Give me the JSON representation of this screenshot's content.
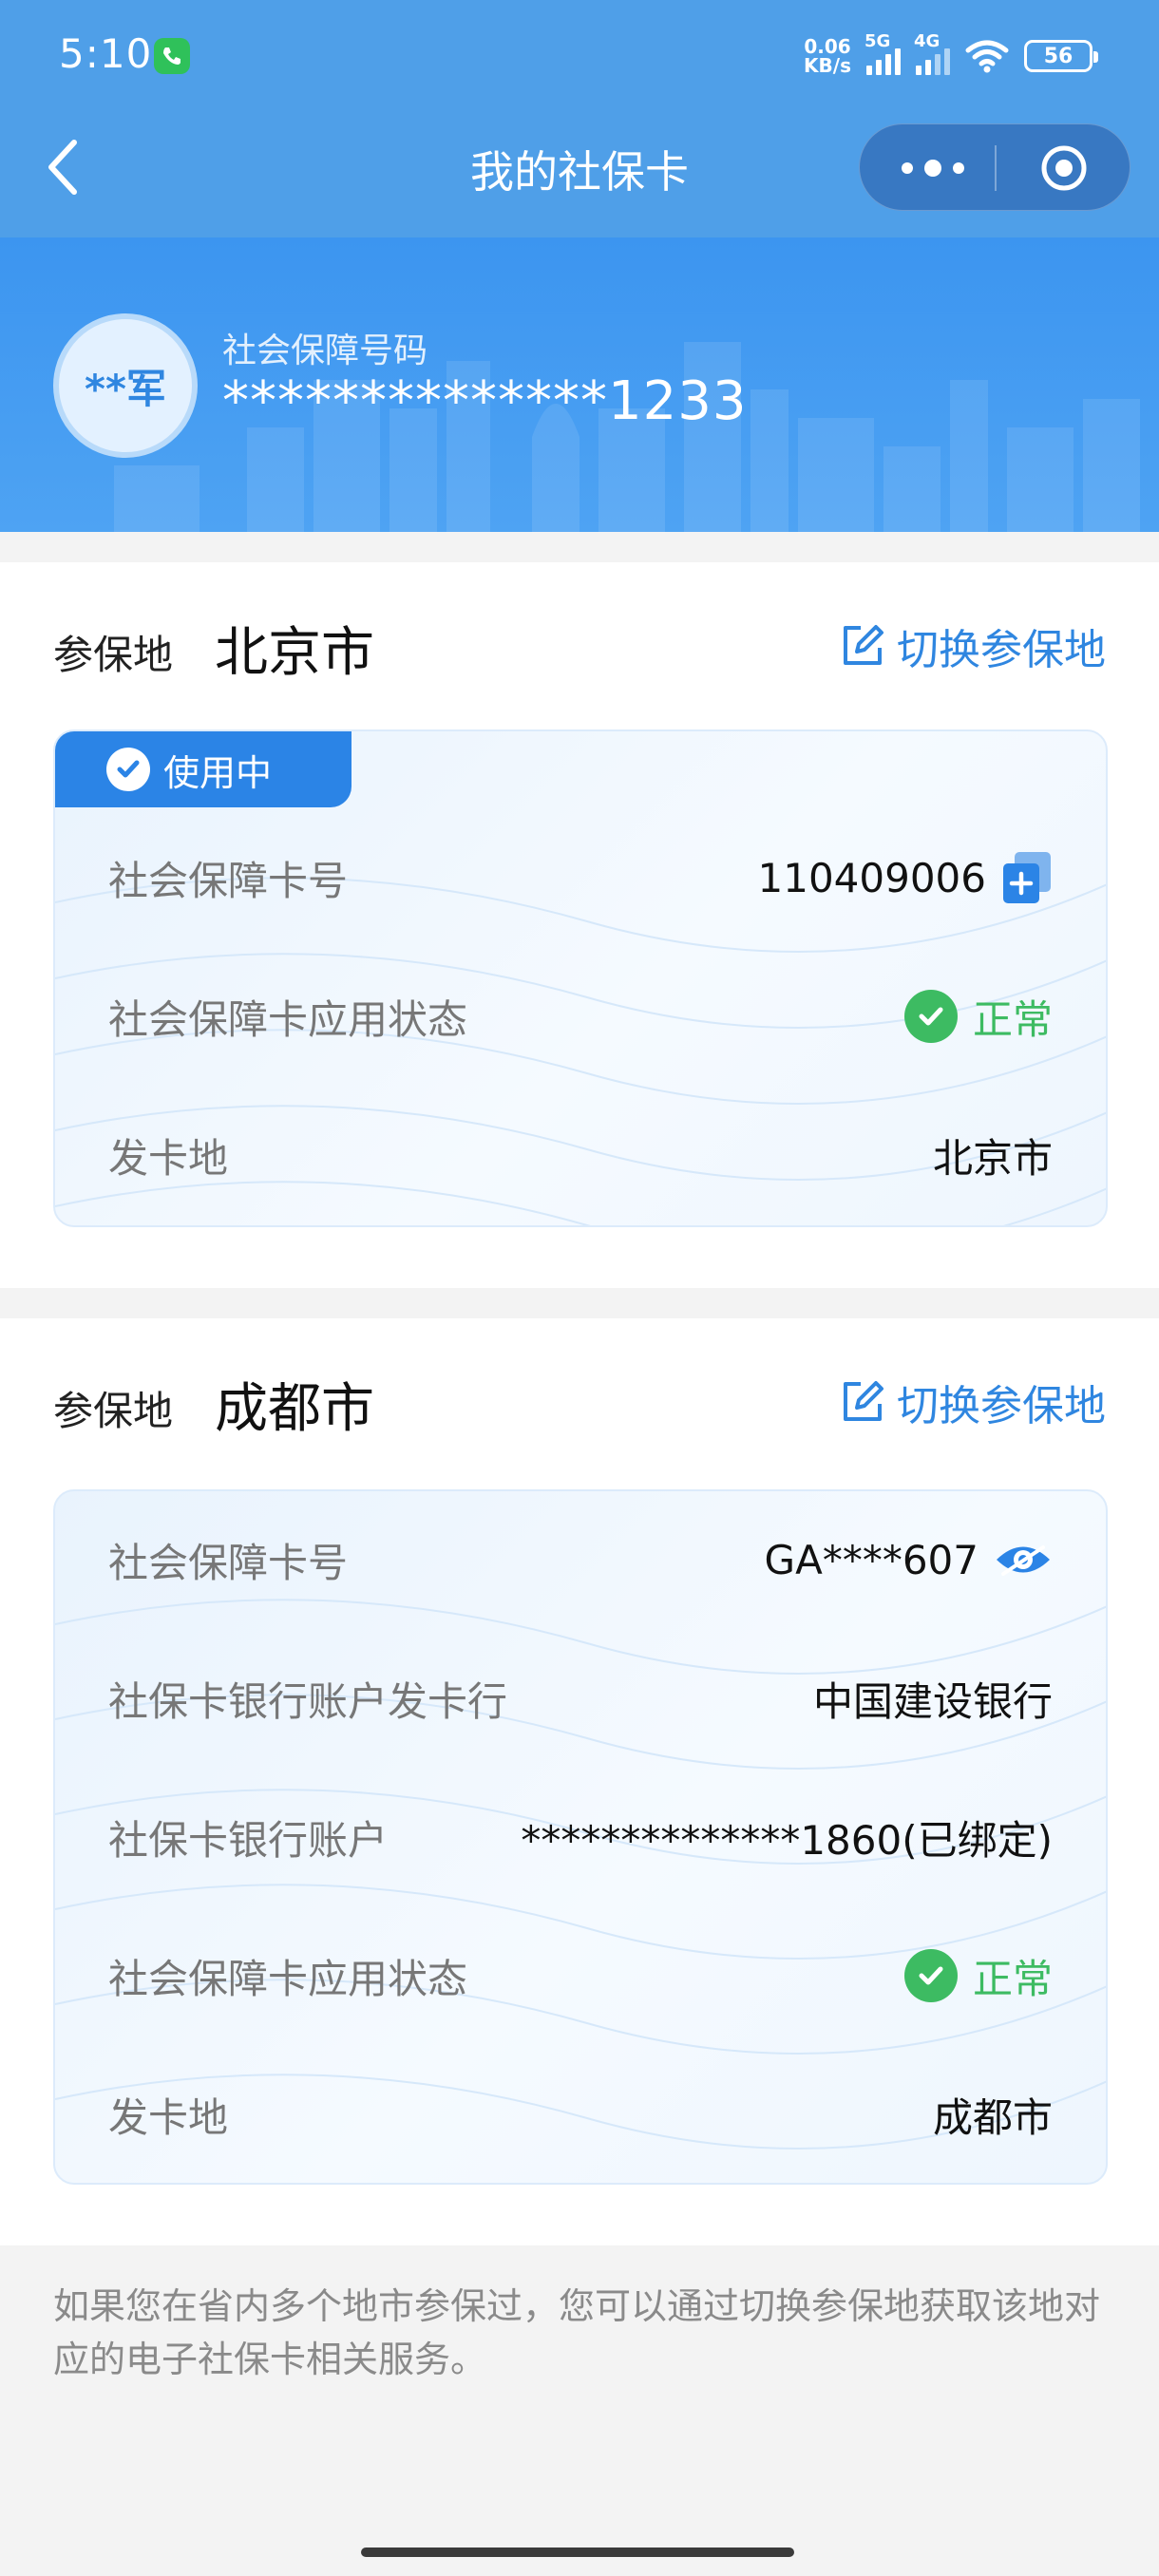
{
  "status_bar": {
    "time": "5:10",
    "net_speed_top": "0.06",
    "net_speed_bottom": "KB/s",
    "sig1_tag": "5G",
    "sig2_tag": "4G",
    "battery": "56"
  },
  "nav": {
    "title": "我的社保卡"
  },
  "header": {
    "avatar_text": "**军",
    "ssn_label": "社会保障号码",
    "ssn_value": "**************1233"
  },
  "sections": [
    {
      "location_label": "参保地",
      "city": "北京市",
      "switch_label": "切换参保地",
      "badge": "使用中",
      "rows": [
        {
          "label": "社会保障卡号",
          "value": "110409006"
        },
        {
          "label": "社会保障卡应用状态",
          "value": "正常"
        },
        {
          "label": "发卡地",
          "value": "北京市"
        }
      ]
    },
    {
      "location_label": "参保地",
      "city": "成都市",
      "switch_label": "切换参保地",
      "rows": [
        {
          "label": "社会保障卡号",
          "value": "GA****607"
        },
        {
          "label": "社保卡银行账户发卡行",
          "value": "中国建设银行"
        },
        {
          "label": "社保卡银行账户",
          "value": "**************1860(已绑定)"
        },
        {
          "label": "社会保障卡应用状态",
          "value": "正常"
        },
        {
          "label": "发卡地",
          "value": "成都市"
        }
      ]
    }
  ],
  "footnote": "如果您在省内多个地市参保过，您可以通过切换参保地获取该地对应的电子社保卡相关服务。",
  "colors": {
    "primary": "#2f86e0",
    "nav_bg": "#4f9fe8",
    "success": "#3dbb62"
  }
}
